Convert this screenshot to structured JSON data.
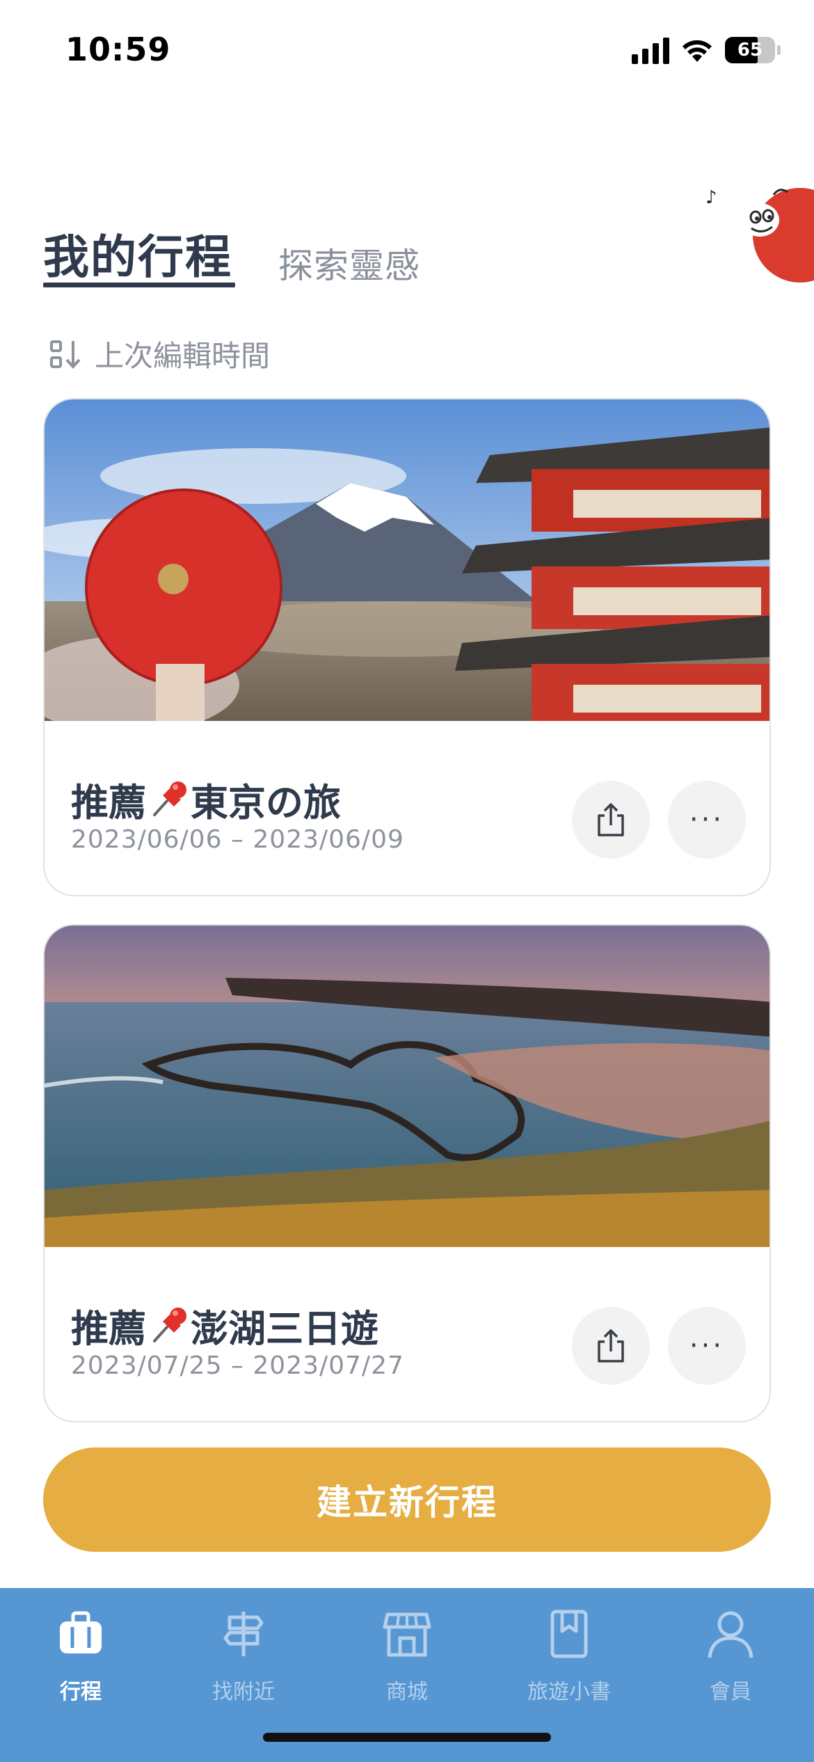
{
  "status_bar": {
    "time": "10:59",
    "battery": "65",
    "battery_level": 0.65
  },
  "tabs": {
    "mine": "我的行程",
    "explore": "探索靈感"
  },
  "sort": {
    "icon": "sort-icon",
    "label": "上次編輯時間"
  },
  "trips": [
    {
      "title_prefix": "推薦",
      "title_name": "東京の旅",
      "dates": "2023/06/06 – 2023/06/09",
      "pin_icon": "pushpin-icon",
      "image": "mount-fuji-pagoda-photo"
    },
    {
      "title_prefix": "推薦",
      "title_name": "澎湖三日遊",
      "dates": "2023/07/25 – 2023/07/27",
      "pin_icon": "pushpin-icon",
      "image": "penghu-double-heart-stone-weir-photo"
    }
  ],
  "actions": {
    "share_icon": "share-icon",
    "more_label": "···"
  },
  "create_button": {
    "label": "建立新行程",
    "color": "#e5ad42"
  },
  "bottom_nav": {
    "color": "#5596d3",
    "items": [
      {
        "label": "行程",
        "icon": "suitcase-icon",
        "active": true
      },
      {
        "label": "找附近",
        "icon": "signpost-icon",
        "active": false
      },
      {
        "label": "商城",
        "icon": "store-icon",
        "active": false
      },
      {
        "label": "旅遊小書",
        "icon": "book-icon",
        "active": false
      },
      {
        "label": "會員",
        "icon": "person-icon",
        "active": false
      }
    ]
  }
}
